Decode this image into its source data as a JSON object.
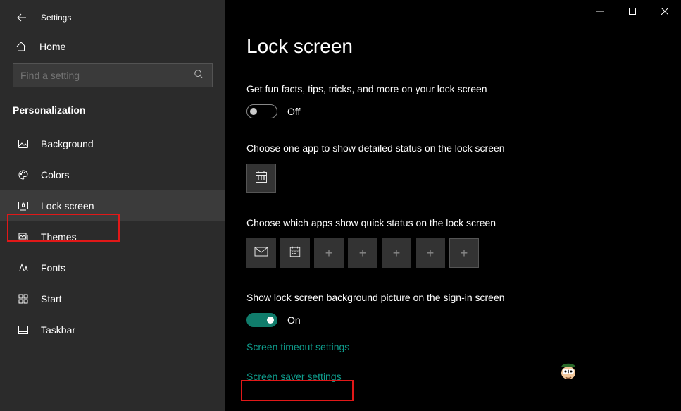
{
  "window": {
    "title": "Settings"
  },
  "sidebar": {
    "home": "Home",
    "search_placeholder": "Find a setting",
    "section": "Personalization",
    "items": [
      {
        "label": "Background"
      },
      {
        "label": "Colors"
      },
      {
        "label": "Lock screen"
      },
      {
        "label": "Themes"
      },
      {
        "label": "Fonts"
      },
      {
        "label": "Start"
      },
      {
        "label": "Taskbar"
      }
    ]
  },
  "main": {
    "title": "Lock screen",
    "fun_facts_label": "Get fun facts, tips, tricks, and more on your lock screen",
    "fun_facts_state": "Off",
    "detailed_label": "Choose one app to show detailed status on the lock screen",
    "quick_label": "Choose which apps show quick status on the lock screen",
    "signin_label": "Show lock screen background picture on the sign-in screen",
    "signin_state": "On",
    "link_timeout": "Screen timeout settings",
    "link_saver": "Screen saver settings"
  }
}
